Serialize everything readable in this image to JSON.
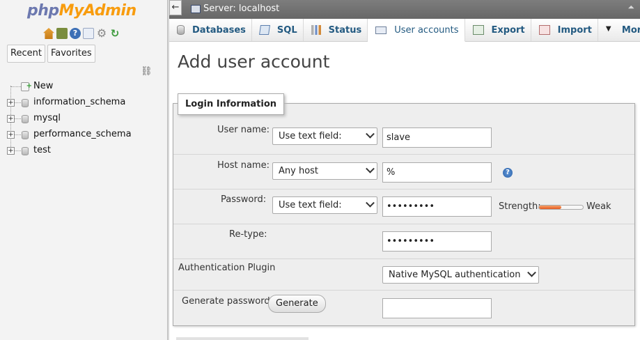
{
  "nav": {
    "logo_part1": "php",
    "logo_part2": "MyAdmin",
    "icons": [
      "home-icon",
      "logout-icon",
      "help-icon",
      "docs-icon",
      "settings-icon",
      "reload-icon"
    ],
    "tabs": [
      "Recent",
      "Favorites"
    ],
    "tree": [
      {
        "label": "New",
        "type": "new"
      },
      {
        "label": "information_schema",
        "type": "db"
      },
      {
        "label": "mysql",
        "type": "db"
      },
      {
        "label": "performance_schema",
        "type": "db"
      },
      {
        "label": "test",
        "type": "db"
      }
    ]
  },
  "serverbar": {
    "label": "Server: localhost",
    "back": "←",
    "collapse": "⏶"
  },
  "tabs": [
    {
      "label": "Databases",
      "icon": "database-icon"
    },
    {
      "label": "SQL",
      "icon": "sql-icon"
    },
    {
      "label": "Status",
      "icon": "status-icon"
    },
    {
      "label": "User accounts",
      "icon": "users-icon",
      "active": true
    },
    {
      "label": "Export",
      "icon": "export-icon"
    },
    {
      "label": "Import",
      "icon": "import-icon"
    },
    {
      "label": "More",
      "icon": "chevron-down-icon"
    }
  ],
  "main": {
    "title": "Add user account",
    "legend": "Login Information",
    "username": {
      "label": "User name:",
      "select": "Use text field:",
      "value": "slave"
    },
    "hostname": {
      "label": "Host name:",
      "select": "Any host",
      "value": "%"
    },
    "password": {
      "label": "Password:",
      "select": "Use text field:",
      "value": "•••••••••",
      "strength_label": "Strength:",
      "strength_text": "Weak",
      "strength_level": 0.2
    },
    "retype": {
      "label": "Re-type:",
      "value": "•••••••••"
    },
    "auth": {
      "label": "Authentication Plugin",
      "select": "Native MySQL authentication"
    },
    "generate": {
      "label": "Generate password:",
      "button": "Generate",
      "value": ""
    }
  }
}
